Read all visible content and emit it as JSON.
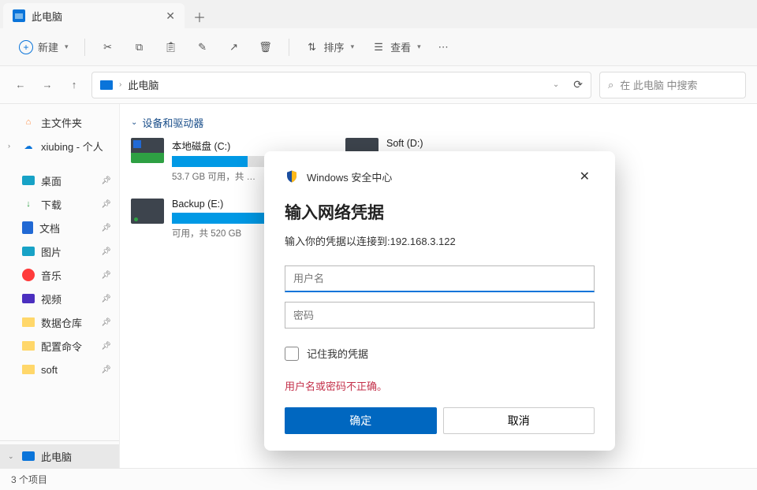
{
  "tab": {
    "title": "此电脑"
  },
  "toolbar": {
    "new_label": "新建",
    "sort_label": "排序",
    "view_label": "查看"
  },
  "nav": {
    "breadcrumb": "此电脑",
    "search_placeholder": "在 此电脑 中搜索"
  },
  "sidebar": {
    "home": "主文件夹",
    "user": "xiubing - 个人",
    "desktop": "桌面",
    "downloads": "下载",
    "documents": "文档",
    "pictures": "图片",
    "music": "音乐",
    "videos": "视频",
    "datawarehouse": "数据仓库",
    "config": "配置命令",
    "soft": "soft",
    "thispc": "此电脑"
  },
  "content": {
    "group_title": "设备和驱动器",
    "drives": [
      {
        "name": "本地磁盘 (C:)",
        "info": "53.7 GB 可用，共 …",
        "fill_pct": 48,
        "type": "sys"
      },
      {
        "name": "Soft (D:)",
        "info": "",
        "fill_pct": 55,
        "type": "hdd"
      },
      {
        "name": "Backup (E:)",
        "info": "可用，共 520 GB",
        "fill_pct": 82,
        "type": "hdd"
      }
    ]
  },
  "status": {
    "text": "3 个项目"
  },
  "dialog": {
    "header": "Windows 安全中心",
    "title": "输入网络凭据",
    "subtitle": "输入你的凭据以连接到:192.168.3.122",
    "username_placeholder": "用户名",
    "password_placeholder": "密码",
    "remember_label": "记住我的凭据",
    "error": "用户名或密码不正确。",
    "ok": "确定",
    "cancel": "取消"
  }
}
